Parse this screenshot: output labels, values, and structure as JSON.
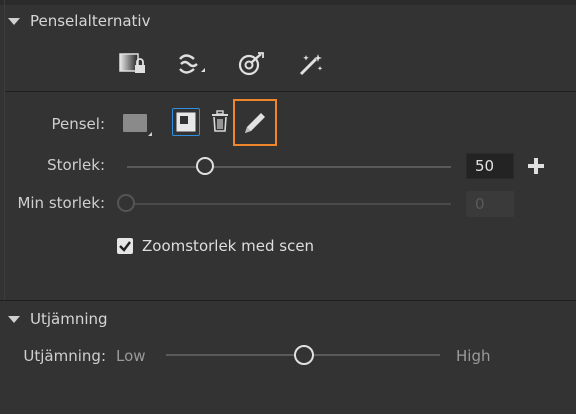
{
  "brush_options": {
    "title": "Penselalternativ",
    "tools": [
      {
        "icon": "brush-lock-icon"
      },
      {
        "icon": "brush-swap-icon"
      },
      {
        "icon": "target-brush-icon"
      },
      {
        "icon": "magic-wand-icon"
      }
    ],
    "brush": {
      "label": "Pensel:",
      "preset_icon": "brush-preset-icon",
      "new_icon": "new-brush-icon",
      "delete_icon": "trash-icon",
      "edit_icon": "pencil-icon",
      "highlight_color": "#f0862c"
    },
    "size": {
      "label": "Storlek:",
      "value": "50",
      "fraction": 0.25
    },
    "min_size": {
      "label": "Min storlek:",
      "value": "0",
      "fraction": 0.0
    },
    "zoom_checkbox": {
      "label": "Zoomstorlek med scen",
      "checked": true
    }
  },
  "smoothing": {
    "title": "Utjämning",
    "label": "Utjämning:",
    "low_label": "Low",
    "high_label": "High",
    "fraction": 0.5
  }
}
